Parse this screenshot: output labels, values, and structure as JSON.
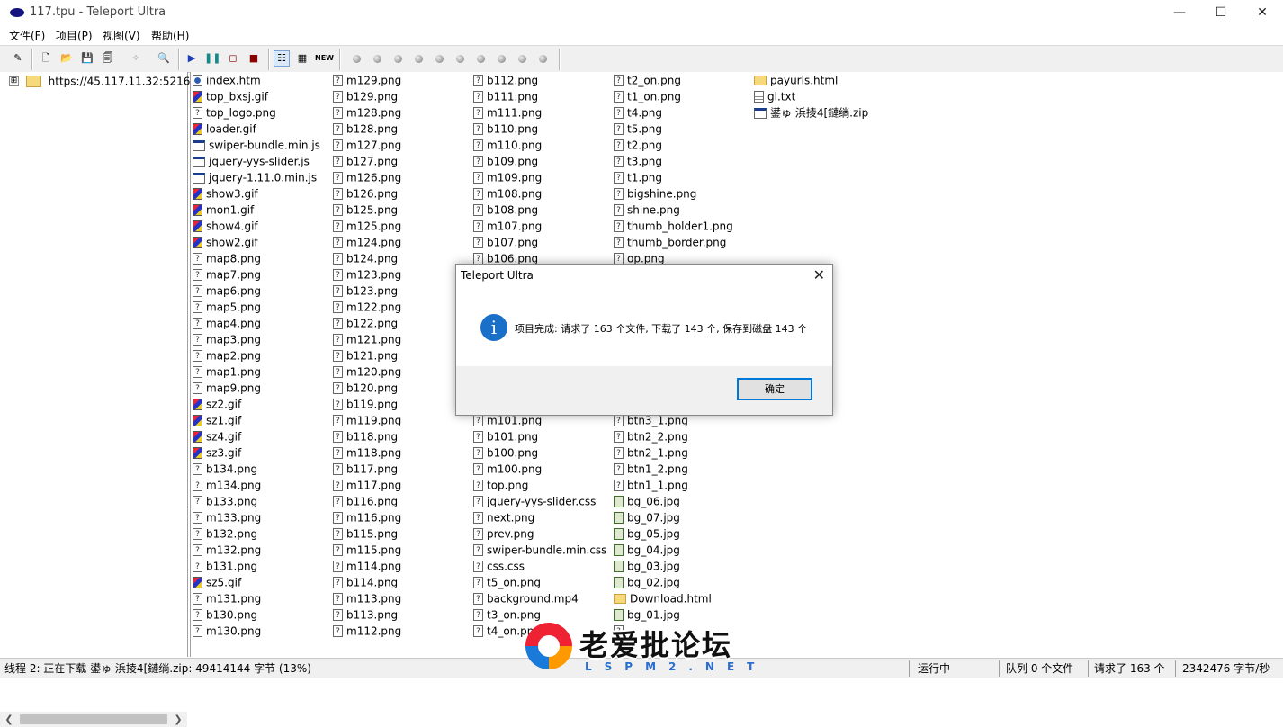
{
  "window": {
    "title": "117.tpu - Teleport Ultra",
    "minimize": "—",
    "maximize": "☐",
    "close": "✕"
  },
  "menu": [
    "文件(F)",
    "项目(P)",
    "视图(V)",
    "帮助(H)"
  ],
  "toolbar": {
    "new_label": "NEW"
  },
  "tree": {
    "expander": "⊞",
    "root_url": "https://45.117.11.32:52161/"
  },
  "files": {
    "columns": [
      [
        {
          "name": "index.htm",
          "icon": "web-page-icon"
        },
        {
          "name": "top_bxsj.gif",
          "icon": "image-icon"
        },
        {
          "name": "top_logo.png",
          "icon": "unknown-file-icon"
        },
        {
          "name": "loader.gif",
          "icon": "image-icon"
        },
        {
          "name": "swiper-bundle.min.js",
          "icon": "script-icon"
        },
        {
          "name": "jquery-yys-slider.js",
          "icon": "script-icon"
        },
        {
          "name": "jquery-1.11.0.min.js",
          "icon": "script-icon"
        },
        {
          "name": "show3.gif",
          "icon": "image-icon"
        },
        {
          "name": "mon1.gif",
          "icon": "image-icon"
        },
        {
          "name": "show4.gif",
          "icon": "image-icon"
        },
        {
          "name": "show2.gif",
          "icon": "image-icon"
        },
        {
          "name": "map8.png",
          "icon": "unknown-file-icon"
        },
        {
          "name": "map7.png",
          "icon": "unknown-file-icon"
        },
        {
          "name": "map6.png",
          "icon": "unknown-file-icon"
        },
        {
          "name": "map5.png",
          "icon": "unknown-file-icon"
        },
        {
          "name": "map4.png",
          "icon": "unknown-file-icon"
        },
        {
          "name": "map3.png",
          "icon": "unknown-file-icon"
        },
        {
          "name": "map2.png",
          "icon": "unknown-file-icon"
        },
        {
          "name": "map1.png",
          "icon": "unknown-file-icon"
        },
        {
          "name": "map9.png",
          "icon": "unknown-file-icon"
        },
        {
          "name": "sz2.gif",
          "icon": "image-icon"
        },
        {
          "name": "sz1.gif",
          "icon": "image-icon"
        },
        {
          "name": "sz4.gif",
          "icon": "image-icon"
        },
        {
          "name": "sz3.gif",
          "icon": "image-icon"
        },
        {
          "name": "b134.png",
          "icon": "unknown-file-icon"
        },
        {
          "name": "m134.png",
          "icon": "unknown-file-icon"
        },
        {
          "name": "b133.png",
          "icon": "unknown-file-icon"
        },
        {
          "name": "m133.png",
          "icon": "unknown-file-icon"
        },
        {
          "name": "b132.png",
          "icon": "unknown-file-icon"
        },
        {
          "name": "m132.png",
          "icon": "unknown-file-icon"
        },
        {
          "name": "b131.png",
          "icon": "unknown-file-icon"
        },
        {
          "name": "sz5.gif",
          "icon": "image-icon"
        },
        {
          "name": "m131.png",
          "icon": "unknown-file-icon"
        },
        {
          "name": "b130.png",
          "icon": "unknown-file-icon"
        },
        {
          "name": "m130.png",
          "icon": "unknown-file-icon"
        }
      ],
      [
        {
          "name": "m129.png",
          "icon": "unknown-file-icon"
        },
        {
          "name": "b129.png",
          "icon": "unknown-file-icon"
        },
        {
          "name": "m128.png",
          "icon": "unknown-file-icon"
        },
        {
          "name": "b128.png",
          "icon": "unknown-file-icon"
        },
        {
          "name": "m127.png",
          "icon": "unknown-file-icon"
        },
        {
          "name": "b127.png",
          "icon": "unknown-file-icon"
        },
        {
          "name": "m126.png",
          "icon": "unknown-file-icon"
        },
        {
          "name": "b126.png",
          "icon": "unknown-file-icon"
        },
        {
          "name": "b125.png",
          "icon": "unknown-file-icon"
        },
        {
          "name": "m125.png",
          "icon": "unknown-file-icon"
        },
        {
          "name": "m124.png",
          "icon": "unknown-file-icon"
        },
        {
          "name": "b124.png",
          "icon": "unknown-file-icon"
        },
        {
          "name": "m123.png",
          "icon": "unknown-file-icon"
        },
        {
          "name": "b123.png",
          "icon": "unknown-file-icon"
        },
        {
          "name": "m122.png",
          "icon": "unknown-file-icon"
        },
        {
          "name": "b122.png",
          "icon": "unknown-file-icon"
        },
        {
          "name": "m121.png",
          "icon": "unknown-file-icon"
        },
        {
          "name": "b121.png",
          "icon": "unknown-file-icon"
        },
        {
          "name": "m120.png",
          "icon": "unknown-file-icon"
        },
        {
          "name": "b120.png",
          "icon": "unknown-file-icon"
        },
        {
          "name": "b119.png",
          "icon": "unknown-file-icon"
        },
        {
          "name": "m119.png",
          "icon": "unknown-file-icon"
        },
        {
          "name": "b118.png",
          "icon": "unknown-file-icon"
        },
        {
          "name": "m118.png",
          "icon": "unknown-file-icon"
        },
        {
          "name": "b117.png",
          "icon": "unknown-file-icon"
        },
        {
          "name": "m117.png",
          "icon": "unknown-file-icon"
        },
        {
          "name": "b116.png",
          "icon": "unknown-file-icon"
        },
        {
          "name": "m116.png",
          "icon": "unknown-file-icon"
        },
        {
          "name": "b115.png",
          "icon": "unknown-file-icon"
        },
        {
          "name": "m115.png",
          "icon": "unknown-file-icon"
        },
        {
          "name": "m114.png",
          "icon": "unknown-file-icon"
        },
        {
          "name": "b114.png",
          "icon": "unknown-file-icon"
        },
        {
          "name": "m113.png",
          "icon": "unknown-file-icon"
        },
        {
          "name": "b113.png",
          "icon": "unknown-file-icon"
        },
        {
          "name": "m112.png",
          "icon": "unknown-file-icon"
        }
      ],
      [
        {
          "name": "b112.png",
          "icon": "unknown-file-icon"
        },
        {
          "name": "b111.png",
          "icon": "unknown-file-icon"
        },
        {
          "name": "m111.png",
          "icon": "unknown-file-icon"
        },
        {
          "name": "b110.png",
          "icon": "unknown-file-icon"
        },
        {
          "name": "m110.png",
          "icon": "unknown-file-icon"
        },
        {
          "name": "b109.png",
          "icon": "unknown-file-icon"
        },
        {
          "name": "m109.png",
          "icon": "unknown-file-icon"
        },
        {
          "name": "m108.png",
          "icon": "unknown-file-icon"
        },
        {
          "name": "b108.png",
          "icon": "unknown-file-icon"
        },
        {
          "name": "m107.png",
          "icon": "unknown-file-icon"
        },
        {
          "name": "b107.png",
          "icon": "unknown-file-icon"
        },
        {
          "name": "b106.png",
          "icon": "unknown-file-icon"
        },
        {
          "name": "",
          "icon": "unknown-file-icon"
        },
        {
          "name": "",
          "icon": "unknown-file-icon"
        },
        {
          "name": "",
          "icon": "unknown-file-icon"
        },
        {
          "name": "",
          "icon": "unknown-file-icon"
        },
        {
          "name": "",
          "icon": "unknown-file-icon"
        },
        {
          "name": "",
          "icon": "unknown-file-icon"
        },
        {
          "name": "",
          "icon": "unknown-file-icon"
        },
        {
          "name": "",
          "icon": "unknown-file-icon"
        },
        {
          "name": "",
          "icon": "unknown-file-icon"
        },
        {
          "name": "m101.png",
          "icon": "unknown-file-icon"
        },
        {
          "name": "b101.png",
          "icon": "unknown-file-icon"
        },
        {
          "name": "b100.png",
          "icon": "unknown-file-icon"
        },
        {
          "name": "m100.png",
          "icon": "unknown-file-icon"
        },
        {
          "name": "top.png",
          "icon": "unknown-file-icon"
        },
        {
          "name": "jquery-yys-slider.css",
          "icon": "unknown-file-icon"
        },
        {
          "name": "next.png",
          "icon": "unknown-file-icon"
        },
        {
          "name": "prev.png",
          "icon": "unknown-file-icon"
        },
        {
          "name": "swiper-bundle.min.css",
          "icon": "unknown-file-icon"
        },
        {
          "name": "css.css",
          "icon": "unknown-file-icon"
        },
        {
          "name": "t5_on.png",
          "icon": "unknown-file-icon"
        },
        {
          "name": "background.mp4",
          "icon": "unknown-file-icon"
        },
        {
          "name": "t3_on.png",
          "icon": "unknown-file-icon"
        },
        {
          "name": "t4_on.png",
          "icon": "unknown-file-icon"
        }
      ],
      [
        {
          "name": "t2_on.png",
          "icon": "unknown-file-icon"
        },
        {
          "name": "t1_on.png",
          "icon": "unknown-file-icon"
        },
        {
          "name": "t4.png",
          "icon": "unknown-file-icon"
        },
        {
          "name": "t5.png",
          "icon": "unknown-file-icon"
        },
        {
          "name": "t2.png",
          "icon": "unknown-file-icon"
        },
        {
          "name": "t3.png",
          "icon": "unknown-file-icon"
        },
        {
          "name": "t1.png",
          "icon": "unknown-file-icon"
        },
        {
          "name": "bigshine.png",
          "icon": "unknown-file-icon"
        },
        {
          "name": "shine.png",
          "icon": "unknown-file-icon"
        },
        {
          "name": "thumb_holder1.png",
          "icon": "unknown-file-icon"
        },
        {
          "name": "thumb_border.png",
          "icon": "unknown-file-icon"
        },
        {
          "name": "op.png",
          "icon": "unknown-file-icon"
        },
        {
          "name": "",
          "icon": "unknown-file-icon"
        },
        {
          "name": "",
          "icon": "unknown-file-icon"
        },
        {
          "name": "",
          "icon": "unknown-file-icon"
        },
        {
          "name": "",
          "icon": "unknown-file-icon"
        },
        {
          "name": "",
          "icon": "unknown-file-icon"
        },
        {
          "name": "",
          "icon": "unknown-file-icon"
        },
        {
          "name": "",
          "icon": "unknown-file-icon"
        },
        {
          "name": "",
          "icon": "unknown-file-icon"
        },
        {
          "name": "",
          "icon": "unknown-file-icon"
        },
        {
          "name": "btn3_1.png",
          "icon": "unknown-file-icon"
        },
        {
          "name": "btn2_2.png",
          "icon": "unknown-file-icon"
        },
        {
          "name": "btn2_1.png",
          "icon": "unknown-file-icon"
        },
        {
          "name": "btn1_2.png",
          "icon": "unknown-file-icon"
        },
        {
          "name": "btn1_1.png",
          "icon": "unknown-file-icon"
        },
        {
          "name": "bg_06.jpg",
          "icon": "jpeg-icon"
        },
        {
          "name": "bg_07.jpg",
          "icon": "jpeg-icon"
        },
        {
          "name": "bg_05.jpg",
          "icon": "jpeg-icon"
        },
        {
          "name": "bg_04.jpg",
          "icon": "jpeg-icon"
        },
        {
          "name": "bg_03.jpg",
          "icon": "jpeg-icon"
        },
        {
          "name": "bg_02.jpg",
          "icon": "jpeg-icon"
        },
        {
          "name": "Download.html",
          "icon": "folder-icon"
        },
        {
          "name": "bg_01.jpg",
          "icon": "jpeg-icon"
        },
        {
          "name": "",
          "icon": "unknown-file-icon"
        }
      ],
      [
        {
          "name": "payurls.html",
          "icon": "folder-icon"
        },
        {
          "name": "gl.txt",
          "icon": "text-file-icon"
        },
        {
          "name": "鍙ゅ   浜掕4[鏈绱.zip",
          "icon": "archive-icon"
        }
      ]
    ]
  },
  "dialog": {
    "title": "Teleport Ultra",
    "close": "✕",
    "message": "项目完成: 请求了 163 个文件, 下载了 143 个, 保存到磁盘 143 个",
    "info_glyph": "i",
    "ok_label": "确定"
  },
  "status": {
    "thread": "线程 2: 正在下载 鍙ゅ    浜掕4[鏈绱.zip: 49414144 字节 (13%)",
    "state": "运行中",
    "queue": "队列 0 个文件",
    "requested": "请求了 163 个",
    "rate": "2342476 字节/秒"
  },
  "watermark": {
    "title": "老爱批论坛",
    "subtitle": "LSPM2.NET"
  }
}
